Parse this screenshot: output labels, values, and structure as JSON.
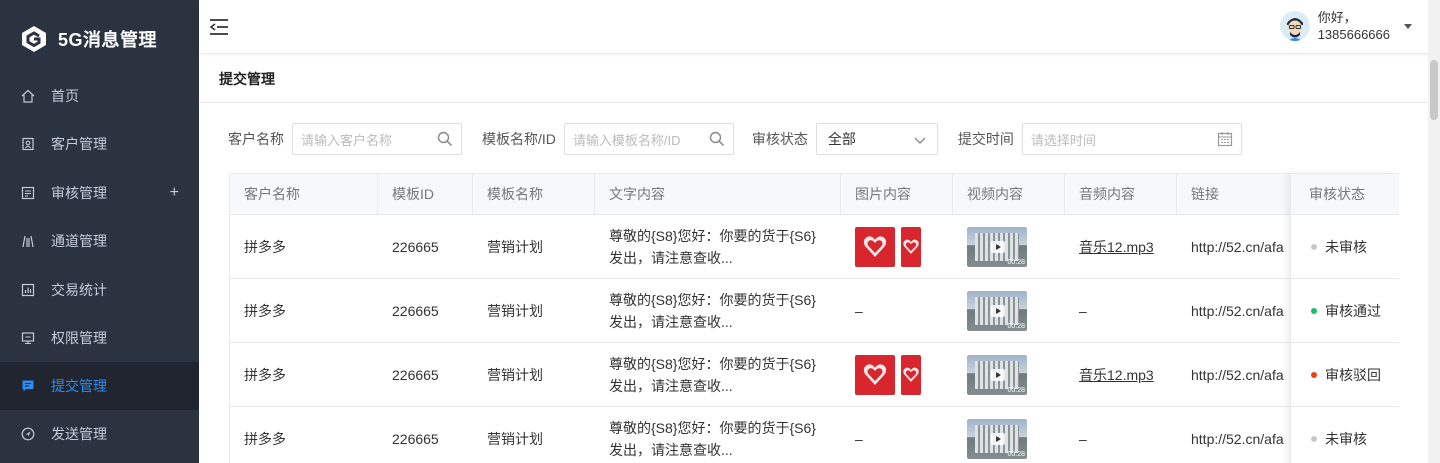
{
  "app": {
    "title": "5G消息管理"
  },
  "sidebar": {
    "items": [
      {
        "label": "首页",
        "icon": "home-icon"
      },
      {
        "label": "客户管理",
        "icon": "customer-icon"
      },
      {
        "label": "审核管理",
        "icon": "review-icon"
      },
      {
        "label": "通道管理",
        "icon": "channel-icon"
      },
      {
        "label": "交易统计",
        "icon": "stats-icon"
      },
      {
        "label": "权限管理",
        "icon": "permission-icon"
      },
      {
        "label": "提交管理",
        "icon": "submit-icon"
      },
      {
        "label": "发送管理",
        "icon": "send-icon"
      }
    ],
    "expand_symbol": "+"
  },
  "header": {
    "greeting": "你好，",
    "phone": "1385666666"
  },
  "page": {
    "title": "提交管理"
  },
  "filters": {
    "customer_label": "客户名称",
    "customer_placeholder": "请输入客户名称",
    "template_label": "模板名称/ID",
    "template_placeholder": "请输入模板名称/ID",
    "status_label": "审核状态",
    "status_value": "全部",
    "time_label": "提交时间",
    "time_placeholder": "请选择时间"
  },
  "table": {
    "columns": [
      "客户名称",
      "模板ID",
      "模板名称",
      "文字内容",
      "图片内容",
      "视频内容",
      "音频内容",
      "链接",
      "审核状态"
    ],
    "video_duration": "00:28",
    "rows": [
      {
        "customer": "拼多多",
        "template_id": "226665",
        "template_name": "营销计划",
        "text": "尊敬的{S8}您好：你要的货于{S6}发出，请注意查收...",
        "has_image": true,
        "image_text": "",
        "audio": "音乐12.mp3",
        "link": "http://52.cn/afa",
        "status": "未审核",
        "status_color": "#c5c8ce"
      },
      {
        "customer": "拼多多",
        "template_id": "226665",
        "template_name": "营销计划",
        "text": "尊敬的{S8}您好：你要的货于{S6}发出，请注意查收...",
        "has_image": false,
        "image_text": "–",
        "audio": "–",
        "link": "http://52.cn/afa",
        "status": "审核通过",
        "status_color": "#19be6b"
      },
      {
        "customer": "拼多多",
        "template_id": "226665",
        "template_name": "营销计划",
        "text": "尊敬的{S8}您好：你要的货于{S6}发出，请注意查收...",
        "has_image": true,
        "image_text": "",
        "audio": "音乐12.mp3",
        "link": "http://52.cn/afa",
        "status": "审核驳回",
        "status_color": "#ed4014"
      },
      {
        "customer": "拼多多",
        "template_id": "226665",
        "template_name": "营销计划",
        "text": "尊敬的{S8}您好：你要的货于{S6}发出，请注意查收...",
        "has_image": false,
        "image_text": "–",
        "audio": "–",
        "link": "http://52.cn/afa",
        "status": "未审核",
        "status_color": "#c5c8ce"
      }
    ]
  },
  "colors": {
    "sidebar_bg": "#2b3240",
    "accent": "#2d8cf0",
    "image_red": "#d8262f"
  }
}
